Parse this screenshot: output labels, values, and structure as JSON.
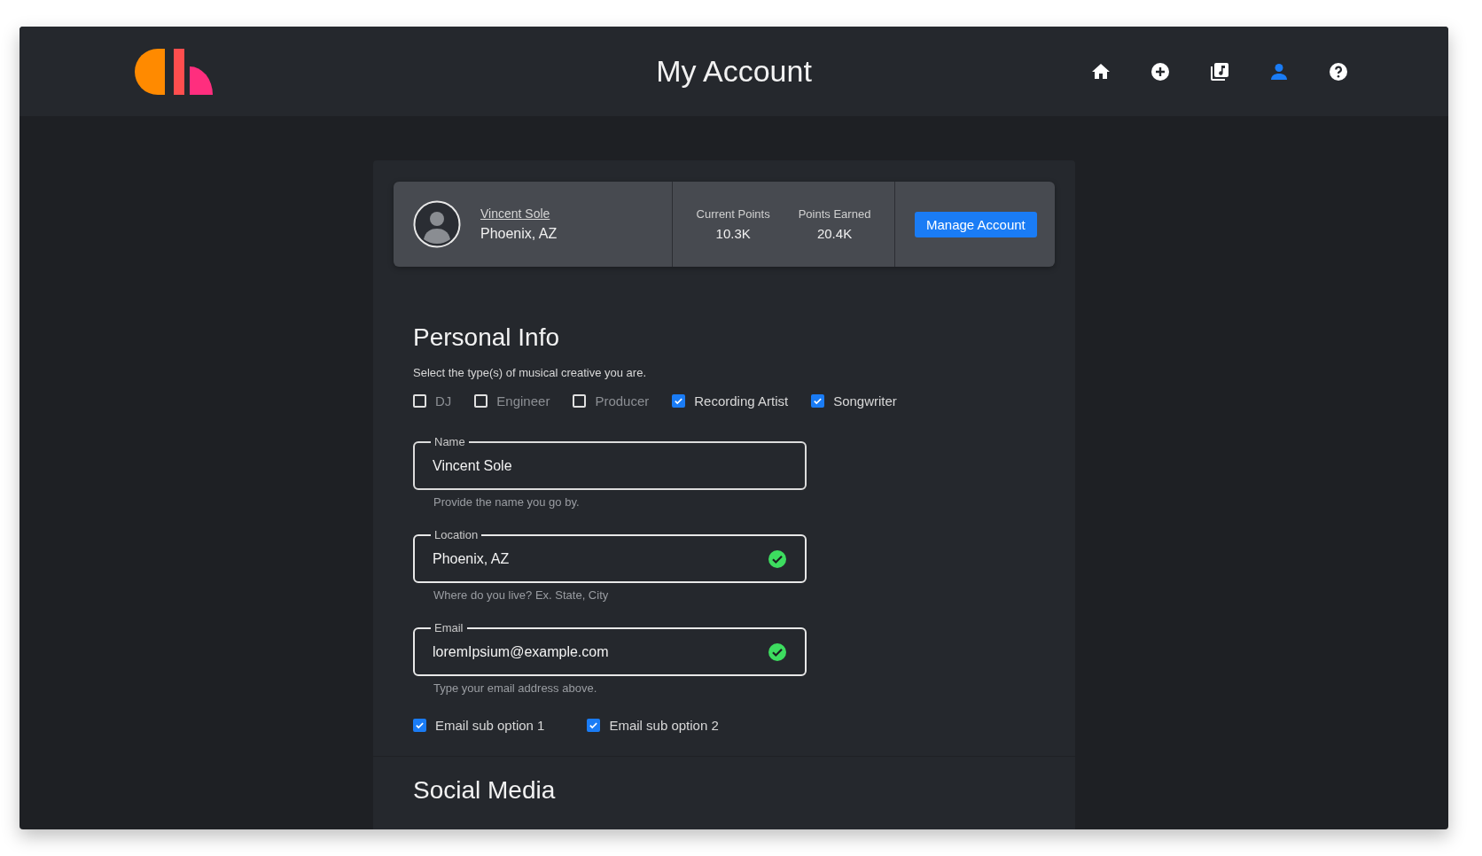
{
  "header": {
    "title": "My Account",
    "nav": [
      {
        "kind": "home",
        "selected": false
      },
      {
        "kind": "add",
        "selected": false
      },
      {
        "kind": "library",
        "selected": false
      },
      {
        "kind": "account",
        "selected": true
      },
      {
        "kind": "help",
        "selected": false
      }
    ]
  },
  "profile": {
    "name": "Vincent Sole",
    "location": "Phoenix, AZ",
    "stats": [
      {
        "label": "Current Points",
        "value": "10.3K"
      },
      {
        "label": "Points Earned",
        "value": "20.4K"
      }
    ],
    "button": "Manage Account"
  },
  "personal_info": {
    "title": "Personal Info",
    "prompt": "Select the type(s) of musical creative you are.",
    "creative_types": [
      {
        "label": "DJ",
        "checked": false
      },
      {
        "label": "Engineer",
        "checked": false
      },
      {
        "label": "Producer",
        "checked": false
      },
      {
        "label": "Recording Artist",
        "checked": true
      },
      {
        "label": "Songwriter",
        "checked": true
      }
    ],
    "fields": [
      {
        "label": "Name",
        "value": "Vincent Sole",
        "helper": "Provide the name you go by.",
        "valid": false
      },
      {
        "label": "Location",
        "value": "Phoenix, AZ",
        "helper": "Where do you live? Ex. State, City",
        "valid": true
      },
      {
        "label": "Email",
        "value": "loremIpsium@example.com",
        "helper": "Type your email address above.",
        "valid": true
      }
    ],
    "email_options": [
      {
        "label": "Email sub option 1",
        "checked": true
      },
      {
        "label": "Email sub option 2",
        "checked": true
      }
    ]
  },
  "social_media": {
    "title": "Social Media"
  }
}
